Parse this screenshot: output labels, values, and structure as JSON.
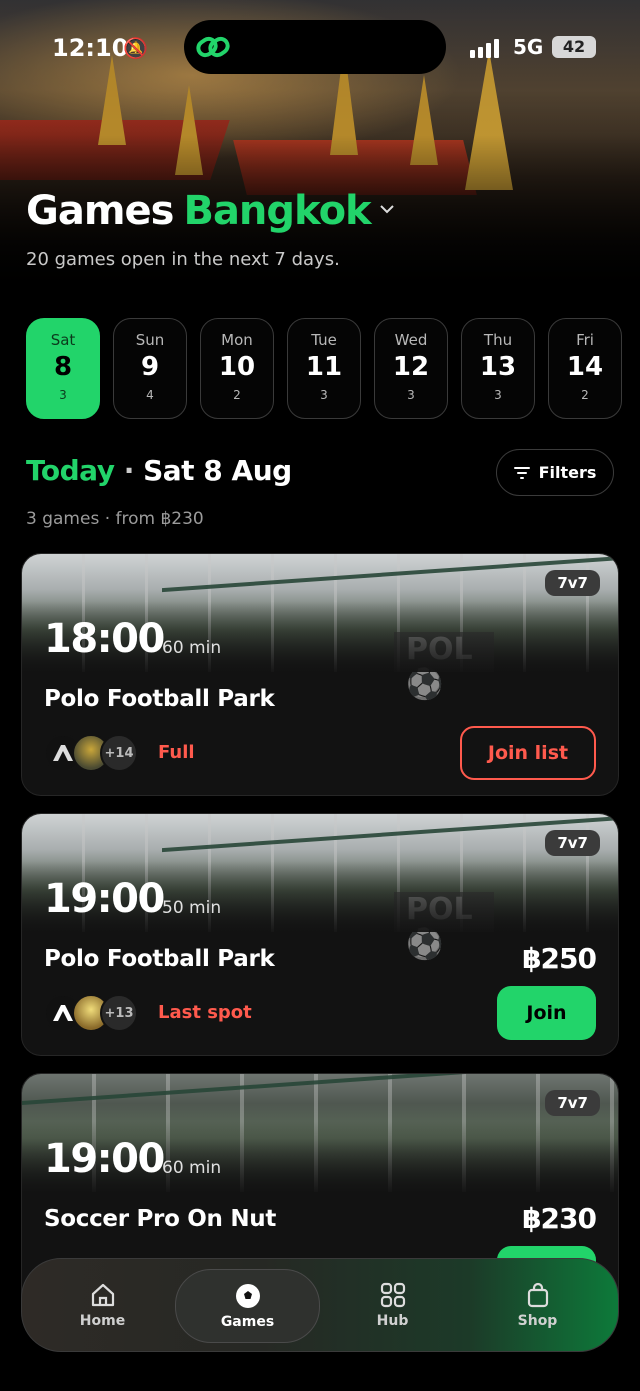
{
  "status_bar": {
    "time": "12:10",
    "network": "5G",
    "battery": "42"
  },
  "header": {
    "title": "Games",
    "city": "Bangkok",
    "subtitle": "20 games open in the next 7 days."
  },
  "dates": [
    {
      "dow": "Sat",
      "day": "8",
      "count": "3",
      "active": true
    },
    {
      "dow": "Sun",
      "day": "9",
      "count": "4"
    },
    {
      "dow": "Mon",
      "day": "10",
      "count": "2"
    },
    {
      "dow": "Tue",
      "day": "11",
      "count": "3"
    },
    {
      "dow": "Wed",
      "day": "12",
      "count": "3"
    },
    {
      "dow": "Thu",
      "day": "13",
      "count": "3"
    },
    {
      "dow": "Fri",
      "day": "14",
      "count": "2"
    }
  ],
  "section": {
    "today": "Today",
    "date": "Sat 8 Aug",
    "meta": "3 games · from ฿230",
    "filters_label": "Filters"
  },
  "games": [
    {
      "time": "18:00",
      "duration": "60 min",
      "venue": "Polo Football Park",
      "format": "7v7",
      "price": "",
      "more_players": "+14",
      "status": "Full",
      "action": "Join list"
    },
    {
      "time": "19:00",
      "duration": "50 min",
      "venue": "Polo Football Park",
      "format": "7v7",
      "price": "฿250",
      "more_players": "+13",
      "status": "Last spot",
      "action": "Join"
    },
    {
      "time": "19:00",
      "duration": "60 min",
      "venue": "Soccer Pro On Nut",
      "format": "7v7",
      "price": "฿230"
    }
  ],
  "tabs": [
    {
      "label": "Home",
      "icon": "home-icon"
    },
    {
      "label": "Games",
      "icon": "ball-icon",
      "active": true
    },
    {
      "label": "Hub",
      "icon": "grid-icon"
    },
    {
      "label": "Shop",
      "icon": "bag-icon"
    }
  ],
  "colors": {
    "accent": "#22d46a",
    "warning": "#ff5a4d",
    "background": "#000000"
  },
  "hero_icon": "link-logo-icon"
}
